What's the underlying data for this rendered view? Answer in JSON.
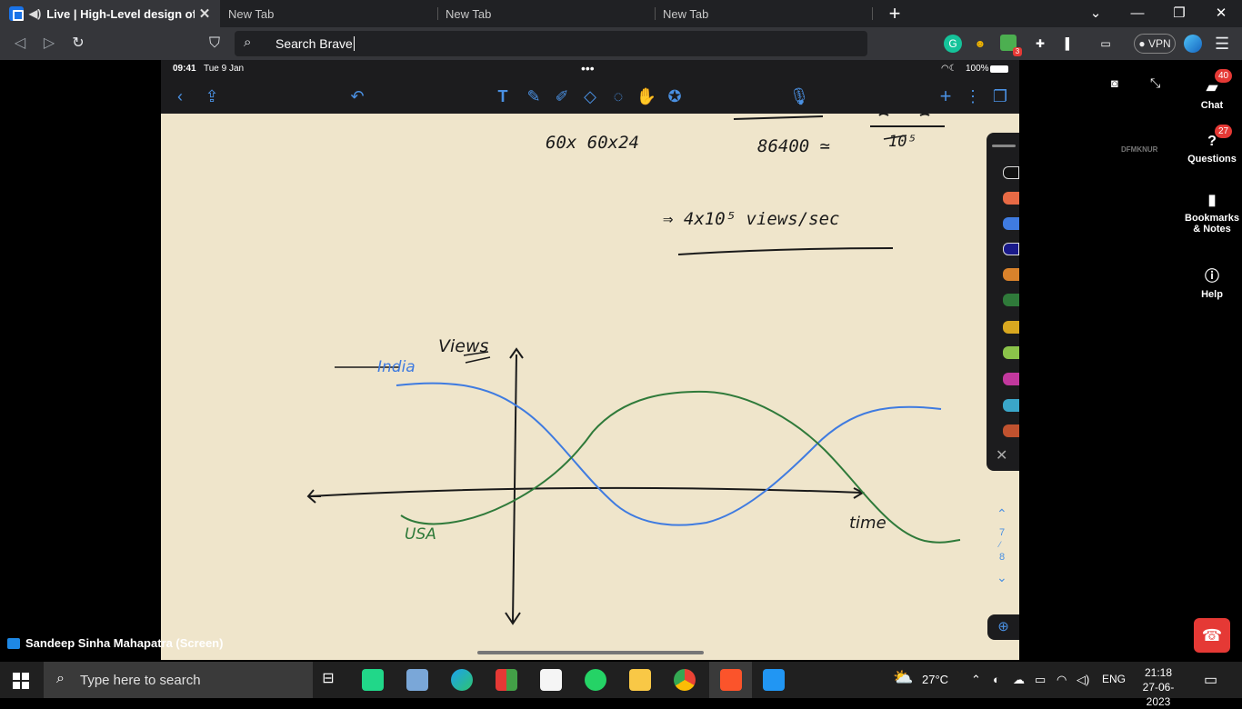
{
  "browser": {
    "tabs": [
      {
        "title": "Live | High-Level design of You",
        "active": true
      },
      {
        "title": "New Tab",
        "active": false
      },
      {
        "title": "New Tab",
        "active": false
      },
      {
        "title": "New Tab",
        "active": false
      }
    ],
    "omnibox_text": "Search Brave",
    "vpn_label": "VPN",
    "ext_badge": "3"
  },
  "ipad": {
    "time": "09:41",
    "date": "Tue 9 Jan",
    "battery": "100%"
  },
  "whiteboard": {
    "handwriting": {
      "formula_1": "60x 60x24",
      "formula_2": "86400 ≃",
      "formula_3": "10⁵",
      "result": "⇒ 4x10⁵ views/sec",
      "y_axis_label": "Views",
      "series_1_label": "India",
      "series_2_label": "USA",
      "x_axis_label": "time"
    },
    "page_current": "7",
    "page_total": "8"
  },
  "presenter": "Sandeep Sinha Mahapatra (Screen)",
  "meeting_panel": {
    "chat_label": "Chat",
    "chat_badge": "40",
    "questions_label": "Questions",
    "questions_badge": "27",
    "bookmarks_label": "Bookmarks & Notes",
    "help_label": "Help",
    "meeting_code": "DFMKNUR"
  },
  "taskbar": {
    "search_placeholder": "Type here to search",
    "temperature": "27°C",
    "language": "ENG",
    "time": "21:18",
    "date": "27-06-2023"
  },
  "colors": {
    "india_curve": "#3f7be0",
    "usa_curve": "#2f7a3a",
    "ink": "#1a1a1a",
    "paper": "#efe5cb",
    "accent": "#4a90e2"
  }
}
